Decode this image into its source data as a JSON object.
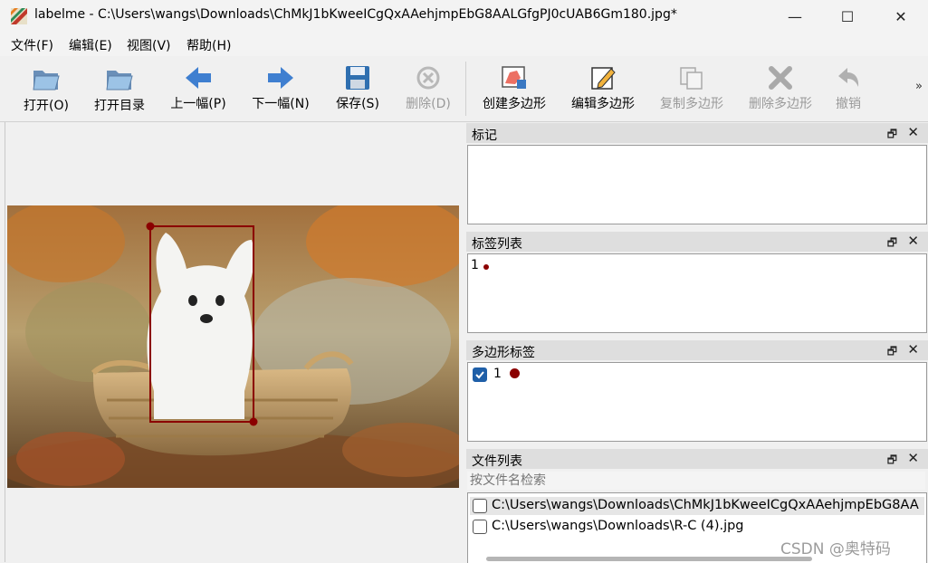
{
  "window": {
    "title": "labelme - C:\\Users\\wangs\\Downloads\\ChMkJ1bKweeICgQxAAehjmpEbG8AALGfgPJ0cUAB6Gm180.jpg*",
    "minimize_glyph": "—",
    "maximize_glyph": "☐",
    "close_glyph": "✕"
  },
  "menu": {
    "items": [
      "文件(F)",
      "编辑(E)",
      "视图(V)",
      "帮助(H)"
    ]
  },
  "toolbar": {
    "buttons": [
      {
        "label": "打开(O)",
        "icon": "folder-open-icon",
        "enabled": true
      },
      {
        "label": "打开目录",
        "icon": "folder-open-icon",
        "enabled": true
      },
      {
        "label": "上一幅(P)",
        "icon": "arrow-left-icon",
        "enabled": true
      },
      {
        "label": "下一幅(N)",
        "icon": "arrow-right-icon",
        "enabled": true
      },
      {
        "label": "保存(S)",
        "icon": "floppy-disk-icon",
        "enabled": true
      },
      {
        "label": "删除(D)",
        "icon": "delete-circle-icon",
        "enabled": false
      },
      {
        "label": "创建多边形",
        "icon": "create-polygon-icon",
        "enabled": true
      },
      {
        "label": "编辑多边形",
        "icon": "edit-polygon-icon",
        "enabled": true
      },
      {
        "label": "复制多边形",
        "icon": "copy-polygon-icon",
        "enabled": false
      },
      {
        "label": "删除多边形",
        "icon": "delete-polygon-icon",
        "enabled": false
      },
      {
        "label": "撤销",
        "icon": "undo-icon",
        "enabled": false
      }
    ],
    "more": "»"
  },
  "docks": {
    "flags": {
      "title": "标记"
    },
    "label_list": {
      "title": "标签列表",
      "items": [
        {
          "text": "1",
          "color": "#8b0000"
        }
      ]
    },
    "polygon_labels": {
      "title": "多边形标签",
      "items": [
        {
          "text": "1",
          "checked": true,
          "color": "#8b0000"
        }
      ]
    },
    "file_list": {
      "title": "文件列表",
      "search_placeholder": "按文件名检索",
      "files": [
        {
          "path": "C:\\Users\\wangs\\Downloads\\ChMkJ1bKweeICgQxAAehjmpEbG8AA",
          "checked": false
        },
        {
          "path": "C:\\Users\\wangs\\Downloads\\R-C (4).jpg",
          "checked": false
        }
      ]
    },
    "float_glyph": "🗗",
    "close_glyph": "✕"
  },
  "annotation": {
    "label": "1",
    "color": "#8b0000"
  },
  "watermark": "CSDN @奥特码"
}
